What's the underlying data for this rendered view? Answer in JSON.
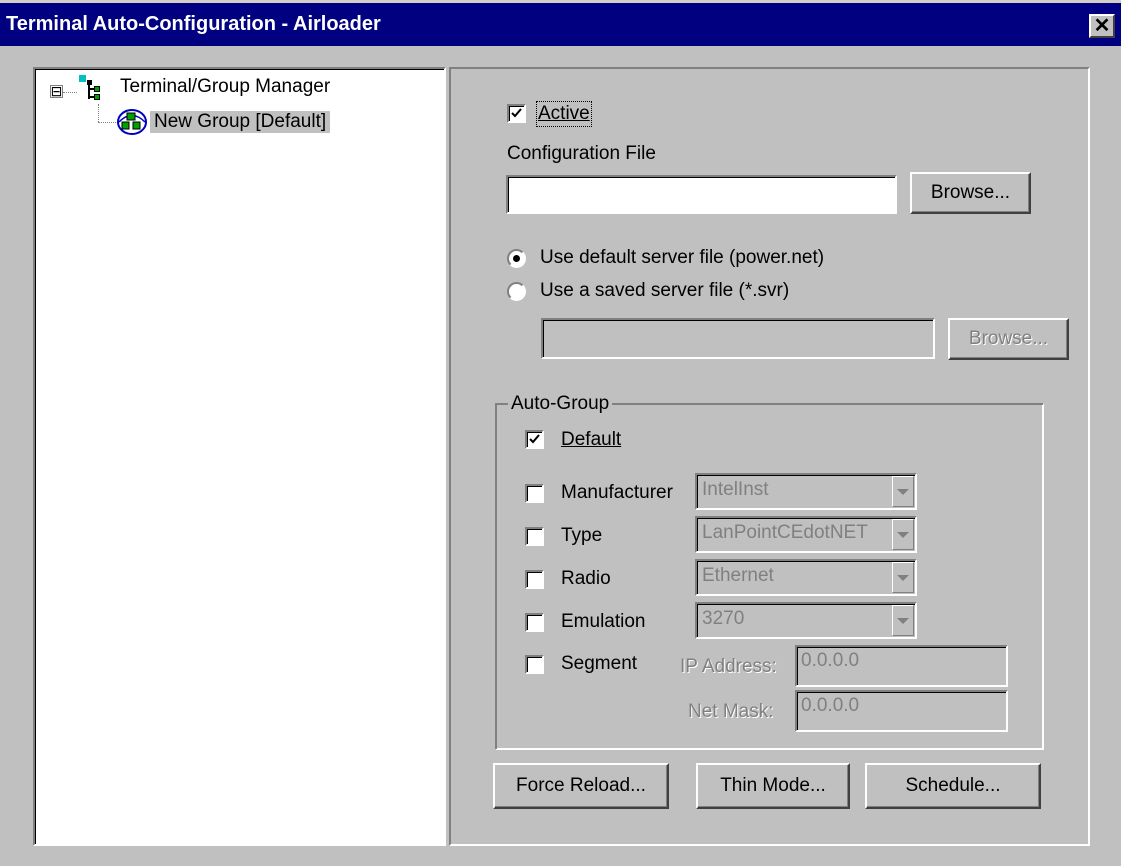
{
  "window": {
    "title": "Terminal Auto-Configuration - Airloader",
    "close_glyph": "✕"
  },
  "tree": {
    "root_label": "Terminal/Group Manager",
    "root_icon": "hierarchy-icon",
    "expander": "⊟",
    "child_label": "New Group [Default]",
    "child_icon": "group-globe-icon"
  },
  "config": {
    "active_label": "Active",
    "active_checked": true,
    "config_file_label": "Configuration File",
    "config_file_value": "",
    "browse_label": "Browse...",
    "radio_default_label": "Use default server file (power.net)",
    "radio_saved_label": "Use a saved server file (*.svr)",
    "selected_radio": "default",
    "saved_file_value": "",
    "browse2_label": "Browse..."
  },
  "auto_group": {
    "legend": "Auto-Group",
    "default_label": "Default",
    "default_checked": true,
    "manufacturer_label": "Manufacturer",
    "manufacturer_value": "IntelInst",
    "type_label": "Type",
    "type_value": "LanPointCEdotNET",
    "radio_label": "Radio",
    "radio_value": "Ethernet",
    "emulation_label": "Emulation",
    "emulation_value": "3270",
    "segment_label": "Segment",
    "ip_label": "IP Address:",
    "ip_value": "0.0.0.0",
    "mask_label": "Net Mask:",
    "mask_value": "0.0.0.0"
  },
  "buttons": {
    "force_reload": "Force Reload...",
    "thin_mode": "Thin Mode...",
    "schedule": "Schedule..."
  }
}
